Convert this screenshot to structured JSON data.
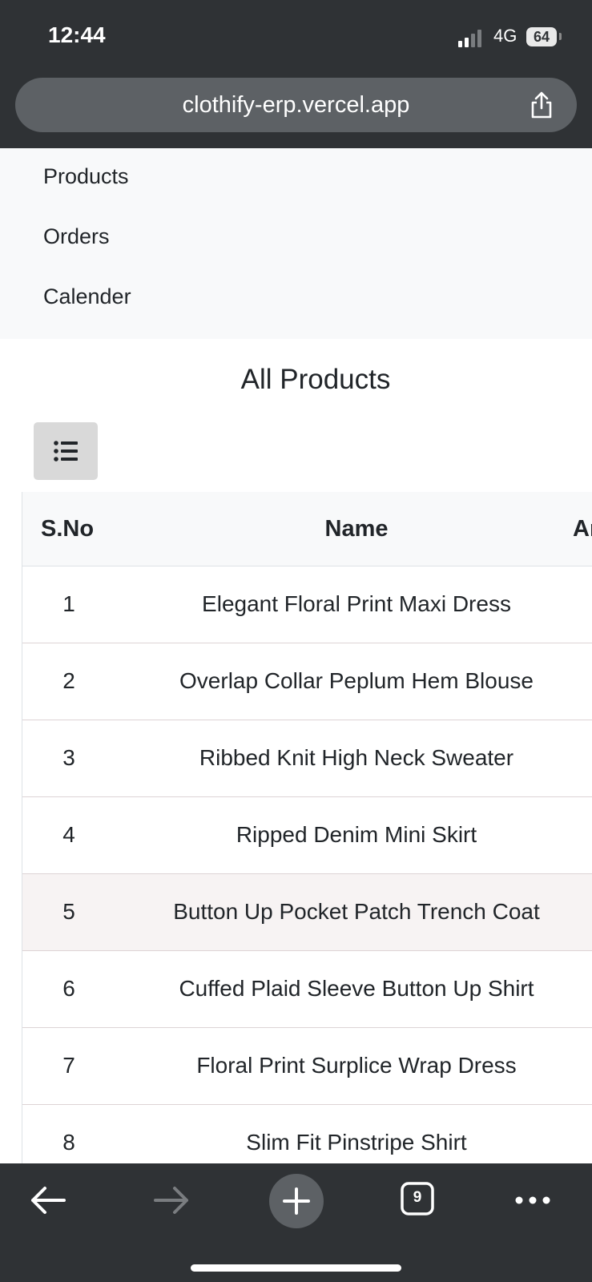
{
  "status_bar": {
    "time": "12:44",
    "network": "4G",
    "battery": "64"
  },
  "browser": {
    "url": "clothify-erp.vercel.app",
    "tab_count": "9"
  },
  "nav": {
    "items": [
      {
        "label": "Products"
      },
      {
        "label": "Orders"
      },
      {
        "label": "Calender"
      }
    ]
  },
  "page": {
    "title": "All Products"
  },
  "table": {
    "columns": [
      "S.No",
      "Name",
      "Ar"
    ],
    "rows": [
      {
        "sno": "1",
        "name": "Elegant Floral Print Maxi Dress",
        "amount": "₹"
      },
      {
        "sno": "2",
        "name": "Overlap Collar Peplum Hem Blouse",
        "amount": "₹"
      },
      {
        "sno": "3",
        "name": "Ribbed Knit High Neck Sweater",
        "amount": "₹"
      },
      {
        "sno": "4",
        "name": "Ripped Denim Mini Skirt",
        "amount": "₹"
      },
      {
        "sno": "5",
        "name": "Button Up Pocket Patch Trench Coat",
        "amount": "₹"
      },
      {
        "sno": "6",
        "name": "Cuffed Plaid Sleeve Button Up Shirt",
        "amount": "₹"
      },
      {
        "sno": "7",
        "name": "Floral Print Surplice Wrap Dress",
        "amount": "₹"
      },
      {
        "sno": "8",
        "name": "Slim Fit Pinstripe Shirt",
        "amount": "₹"
      }
    ]
  },
  "colors": {
    "chrome": "#2f3235",
    "url_bar": "#5d6165",
    "nav_bg": "#f8f9fa",
    "toggle_bg": "#d9d9d9",
    "row_highlight": "#f7f3f3"
  }
}
